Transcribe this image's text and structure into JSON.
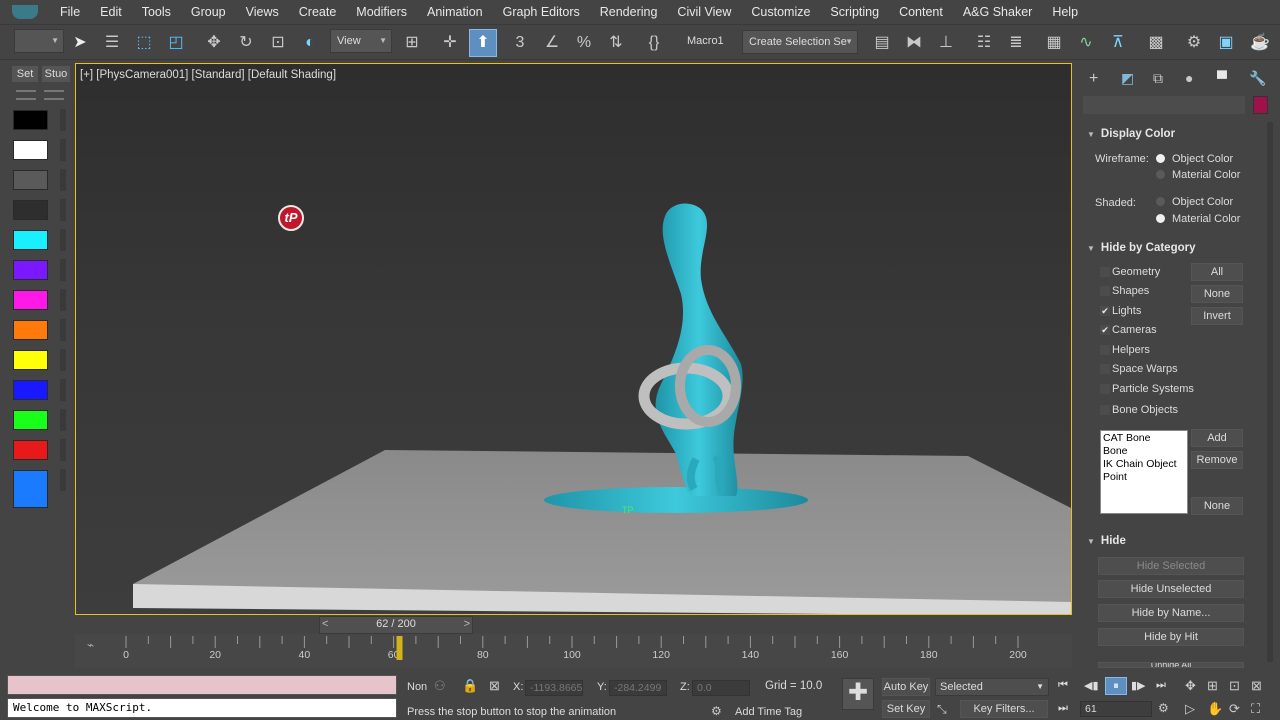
{
  "menu": [
    "File",
    "Edit",
    "Tools",
    "Group",
    "Views",
    "Create",
    "Modifiers",
    "Animation",
    "Graph Editors",
    "Rendering",
    "Civil View",
    "Customize",
    "Scripting",
    "Content",
    "A&G Shaker",
    "Help"
  ],
  "toolbar": {
    "view_dropdown": "View",
    "macro_label": "Macro1",
    "selection_set_placeholder": "Create Selection Se"
  },
  "left_panel": {
    "tab_set": "Set",
    "tab_stud": "Stuo",
    "swatches": [
      "#000000",
      "#ffffff",
      "#5a5a5a",
      "#2e2e2e",
      "#19f0ff",
      "#7a19ff",
      "#ff19e8",
      "#ff7a0a",
      "#ffff0a",
      "#1919ff",
      "#19ff19",
      "#e81919",
      "#1a7bff"
    ]
  },
  "viewport": {
    "label": "[+] [PhysCamera001] [Standard] [Default Shading]",
    "logo_text": "tP",
    "marker_text": "TP"
  },
  "command_panel": {
    "display_color": {
      "title": "Display Color",
      "wireframe_label": "Wireframe:",
      "shaded_label": "Shaded:",
      "object_color": "Object Color",
      "material_color": "Material Color",
      "wireframe_selected": "Object Color",
      "shaded_selected": "Material Color"
    },
    "hide_by_category": {
      "title": "Hide by Category",
      "items": [
        {
          "label": "Geometry",
          "checked": false
        },
        {
          "label": "Shapes",
          "checked": false
        },
        {
          "label": "Lights",
          "checked": true
        },
        {
          "label": "Cameras",
          "checked": true
        },
        {
          "label": "Helpers",
          "checked": false
        },
        {
          "label": "Space Warps",
          "checked": false
        },
        {
          "label": "Particle Systems",
          "checked": false
        },
        {
          "label": "Bone Objects",
          "checked": false
        }
      ],
      "btn_all": "All",
      "btn_none": "None",
      "btn_invert": "Invert",
      "list": [
        "CAT Bone",
        "Bone",
        "IK Chain Object",
        "Point"
      ],
      "btn_add": "Add",
      "btn_remove": "Remove",
      "btn_none2": "None"
    },
    "hide": {
      "title": "Hide",
      "hide_selected": "Hide Selected",
      "hide_unselected": "Hide Unselected",
      "hide_by_name": "Hide by Name...",
      "hide_by_hit": "Hide by Hit",
      "unhide_all": "Unhide All"
    },
    "color_swatch": "#a0104a"
  },
  "timeline": {
    "current_frame": 62,
    "total_frames": 200,
    "frame_display": "62 / 200",
    "prev": "<",
    "next": ">",
    "ticks": [
      "0",
      "20",
      "40",
      "60",
      "80",
      "100",
      "120",
      "140",
      "160",
      "180",
      "200"
    ]
  },
  "status": {
    "maxscript_text": "Welcome to MAXScript.",
    "selection_mode": "Non",
    "x_label": "X:",
    "x_value": "-1193.8665",
    "y_label": "Y:",
    "y_value": "-284.2499",
    "z_label": "Z:",
    "z_value": "0.0",
    "grid": "Grid = 10.0",
    "prompt": "Press the stop button to stop the animation",
    "add_time_tag": "Add Time Tag",
    "auto_key": "Auto Key",
    "set_key": "Set Key",
    "key_mode": "Selected",
    "key_filters": "Key Filters...",
    "frame_field": "61"
  }
}
